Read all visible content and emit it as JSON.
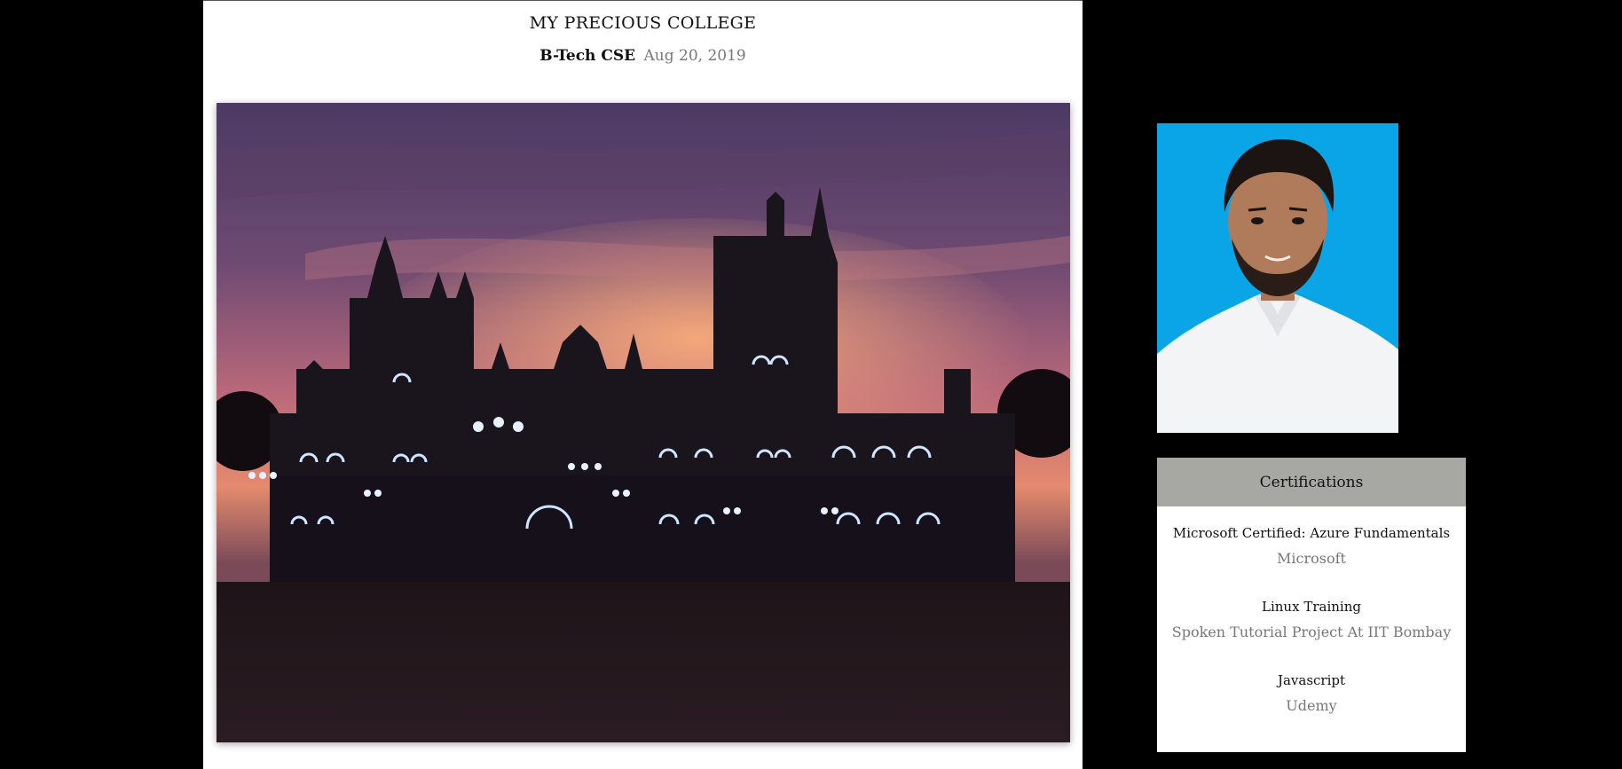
{
  "post": {
    "title": "MY PRECIOUS COLLEGE",
    "category": "B-Tech CSE",
    "date": "Aug 20, 2019"
  },
  "sidebar": {
    "certifications": {
      "heading": "Certifications",
      "items": [
        {
          "name": "Microsoft Certified: Azure Fundamentals",
          "issuer": "Microsoft"
        },
        {
          "name": "Linux Training",
          "issuer": "Spoken Tutorial Project At IIT Bombay"
        },
        {
          "name": "Javascript",
          "issuer": "Udemy"
        }
      ]
    }
  },
  "colors": {
    "page_background": "#000000",
    "card_background": "#ffffff",
    "cert_header_background": "#a7a8a3",
    "muted_text": "#777777",
    "profile_background": "#0aa5e6"
  }
}
